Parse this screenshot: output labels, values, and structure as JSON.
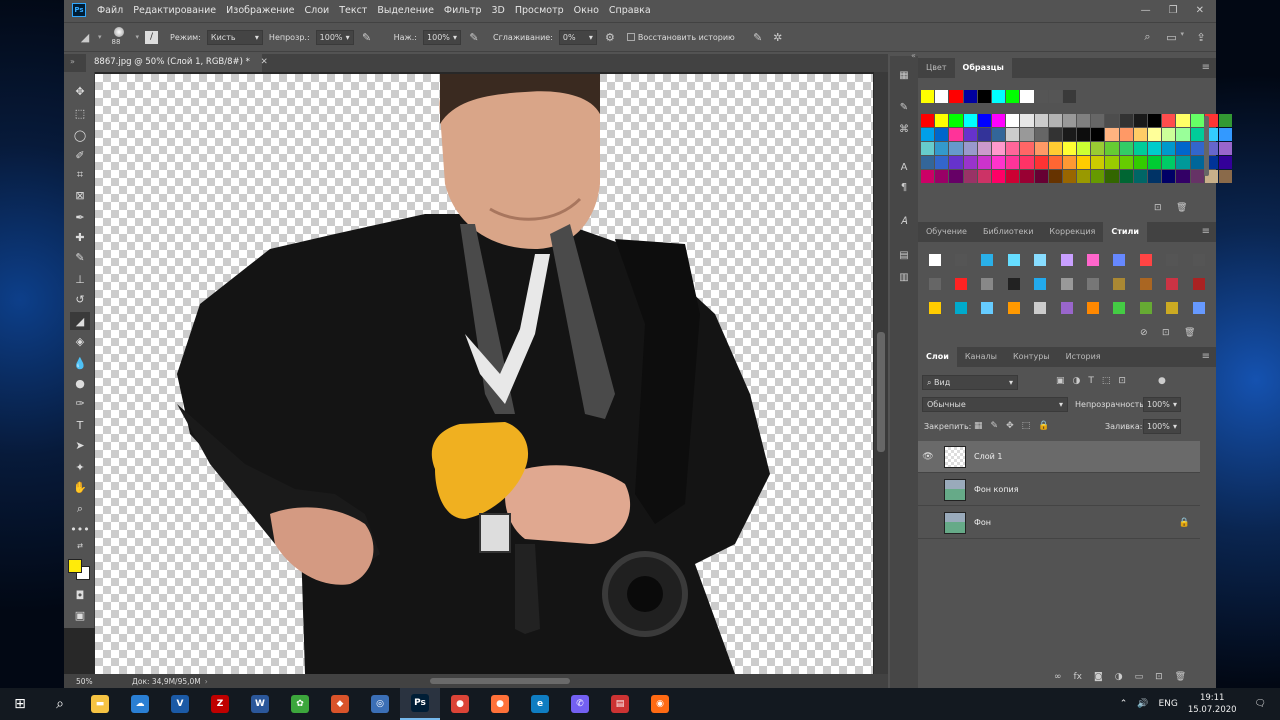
{
  "menu": {
    "logo": "Ps",
    "items": [
      "Файл",
      "Редактирование",
      "Изображение",
      "Слои",
      "Текст",
      "Выделение",
      "Фильтр",
      "3D",
      "Просмотр",
      "Окно",
      "Справка"
    ]
  },
  "options": {
    "brush_size": "88",
    "mode_label": "Режим:",
    "mode_value": "Кисть",
    "opacity_label": "Непрозр.:",
    "opacity_value": "100%",
    "flow_label": "Наж.:",
    "flow_value": "100%",
    "smoothing_label": "Сглаживание:",
    "smoothing_value": "0%",
    "restore_history": "Восстановить историю"
  },
  "document": {
    "tab_title": "8867.jpg @ 50% (Слой 1, RGB/8#) *",
    "zoom": "50%",
    "doc_info": "Док: 34,9M/95,0M"
  },
  "swatches_panel": {
    "tabs": [
      "Цвет",
      "Образцы"
    ],
    "active": "Образцы",
    "recent": [
      "#ffff00",
      "#ffffff",
      "#ff0000",
      "#0000a0",
      "#000000",
      "#00ffff",
      "#00ff00",
      "#ffffff",
      "#555555",
      "#555555",
      "#3a3a3a"
    ],
    "rows": [
      [
        "#ff0000",
        "#ffff00",
        "#00ff00",
        "#00ffff",
        "#0000ff",
        "#ff00ff",
        "#ffffff",
        "#e6e6e6",
        "#cccccc",
        "#b3b3b3",
        "#999999",
        "#808080",
        "#666666",
        "#4d4d4d",
        "#333333",
        "#1a1a1a",
        "#000000",
        "#ff4d4d",
        "#ffff66",
        "#66ff66",
        "#ff3333",
        "#339933"
      ],
      [
        "#00a0e9",
        "#0066cc",
        "#ff3399",
        "#6633cc",
        "#333399",
        "#336699",
        "#cccccc",
        "#999999",
        "#666666",
        "#333333",
        "#1a1a1a",
        "#0d0d0d",
        "#000000",
        "#ffb380",
        "#ff9966",
        "#ffcc66",
        "#ffff99",
        "#ccff99",
        "#99ff99",
        "#00cc99",
        "#33ccff",
        "#3399ff"
      ],
      [
        "#66cccc",
        "#3399cc",
        "#6699cc",
        "#9999cc",
        "#cc99cc",
        "#ff99cc",
        "#ff6699",
        "#ff6666",
        "#ff9966",
        "#ffcc33",
        "#ffff33",
        "#ccff33",
        "#99cc33",
        "#66cc33",
        "#33cc66",
        "#00cc99",
        "#00cccc",
        "#0099cc",
        "#0066cc",
        "#3366cc",
        "#6666cc",
        "#9966cc"
      ],
      [
        "#336699",
        "#3366cc",
        "#6633cc",
        "#9933cc",
        "#cc33cc",
        "#ff33cc",
        "#ff3399",
        "#ff3366",
        "#ff3333",
        "#ff6633",
        "#ff9933",
        "#ffcc00",
        "#cccc00",
        "#99cc00",
        "#66cc00",
        "#33cc00",
        "#00cc33",
        "#00cc66",
        "#009999",
        "#006699",
        "#003399",
        "#330099"
      ],
      [
        "#cc0066",
        "#990066",
        "#660066",
        "#993366",
        "#cc3366",
        "#ff0066",
        "#cc0033",
        "#990033",
        "#660033",
        "#663300",
        "#996600",
        "#999900",
        "#669900",
        "#336600",
        "#006633",
        "#006666",
        "#003366",
        "#000066",
        "#330066",
        "#663366",
        "#c8b08a",
        "#8a6a4a"
      ]
    ]
  },
  "styles_panel": {
    "tabs": [
      "Обучение",
      "Библиотеки",
      "Коррекция",
      "Стили"
    ],
    "active": "Стили",
    "rows": [
      [
        "#ffffff",
        "#555555",
        "#2ab0e8",
        "#66ddff",
        "#88ddff",
        "#c9a0ff",
        "#ff66cc",
        "#6688ff",
        "#ff4444",
        "#555555",
        "#555555"
      ],
      [
        "#666666",
        "#ff2222",
        "#888888",
        "#222222",
        "#22aaee",
        "#999999",
        "#777777",
        "#aa8833",
        "#aa6622",
        "#cc3344",
        "#aa2222"
      ],
      [
        "#ffcc00",
        "#00aacc",
        "#66ccff",
        "#ff9900",
        "#cccccc",
        "#9966cc",
        "#ff8800",
        "#44cc44",
        "#66aa33",
        "#ccaa22",
        "#6699ff"
      ]
    ]
  },
  "layers_panel": {
    "tabs": [
      "Слои",
      "Каналы",
      "Контуры",
      "История"
    ],
    "active": "Слои",
    "filter": "Вид",
    "blend_mode": "Обычные",
    "opacity_label": "Непрозрачность:",
    "opacity_value": "100%",
    "lock_label": "Закрепить:",
    "fill_label": "Заливка:",
    "fill_value": "100%",
    "layers": [
      {
        "name": "Слой 1",
        "visible": true,
        "selected": true,
        "locked": false
      },
      {
        "name": "Фон копия",
        "visible": false,
        "selected": false,
        "locked": false
      },
      {
        "name": "Фон",
        "visible": false,
        "selected": false,
        "locked": true
      }
    ]
  },
  "taskbar": {
    "lang": "ENG",
    "time": "19:11",
    "date": "15.07.2020",
    "apps": [
      {
        "name": "file-explorer",
        "glyph": "▬",
        "color": "#f6c343"
      },
      {
        "name": "cloud",
        "glyph": "☁",
        "color": "#2a7fd4"
      },
      {
        "name": "visio",
        "glyph": "V",
        "color": "#1b5aa6"
      },
      {
        "name": "filezilla",
        "glyph": "Z",
        "color": "#bf0000"
      },
      {
        "name": "word",
        "glyph": "W",
        "color": "#2b579a"
      },
      {
        "name": "utility",
        "glyph": "✿",
        "color": "#3ca63c"
      },
      {
        "name": "app-red",
        "glyph": "◆",
        "color": "#d9532a"
      },
      {
        "name": "browser-globe",
        "glyph": "◎",
        "color": "#3b6fb6"
      },
      {
        "name": "photoshop",
        "glyph": "Ps",
        "color": "#001e36",
        "active": true
      },
      {
        "name": "chrome",
        "glyph": "●",
        "color": "#db4437"
      },
      {
        "name": "firefox",
        "glyph": "●",
        "color": "#ff7139"
      },
      {
        "name": "edge",
        "glyph": "e",
        "color": "#0f7dc2"
      },
      {
        "name": "viber",
        "glyph": "✆",
        "color": "#7360f2"
      },
      {
        "name": "app-chart",
        "glyph": "▤",
        "color": "#cc3333"
      },
      {
        "name": "app-orange",
        "glyph": "◉",
        "color": "#ff6a13"
      }
    ]
  }
}
